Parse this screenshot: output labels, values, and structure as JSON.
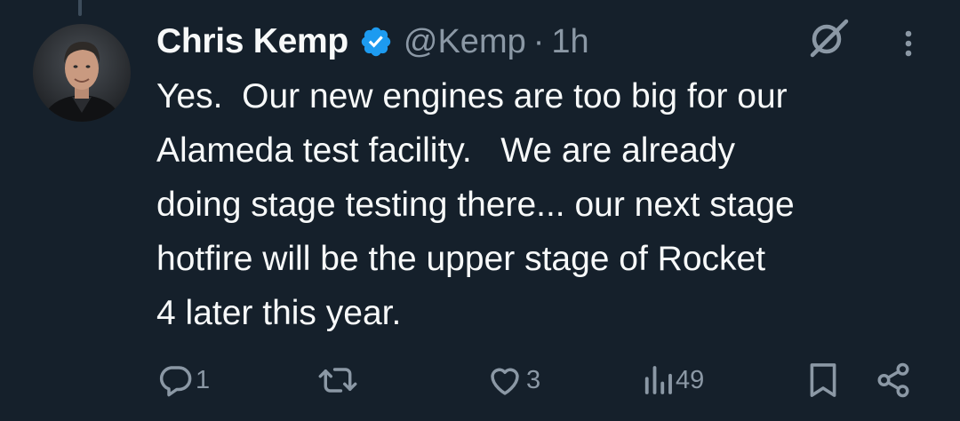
{
  "tweet": {
    "author_name": "Chris Kemp",
    "handle": "@Kemp",
    "separator": "·",
    "time": "1h",
    "text": "Yes.  Our new engines are too big for our\nAlameda test facility.   We are already\ndoing stage testing there... our next stage\nhotfire will be the upper stage of Rocket\n4 later this year."
  },
  "actions": {
    "reply_count": "1",
    "retweet_count": "",
    "like_count": "3",
    "views_count": "49"
  },
  "icons": {
    "verified": "verified-badge-icon",
    "grok": "grok-icon",
    "more": "more-vertical-icon",
    "reply": "reply-icon",
    "retweet": "retweet-icon",
    "like": "heart-icon",
    "views": "views-chart-icon",
    "bookmark": "bookmark-icon",
    "share": "share-icon"
  },
  "colors": {
    "background": "#15202b",
    "primary_text": "#f7f9f9",
    "secondary_text": "#8b98a5",
    "verified_blue": "#1d9bf0"
  }
}
